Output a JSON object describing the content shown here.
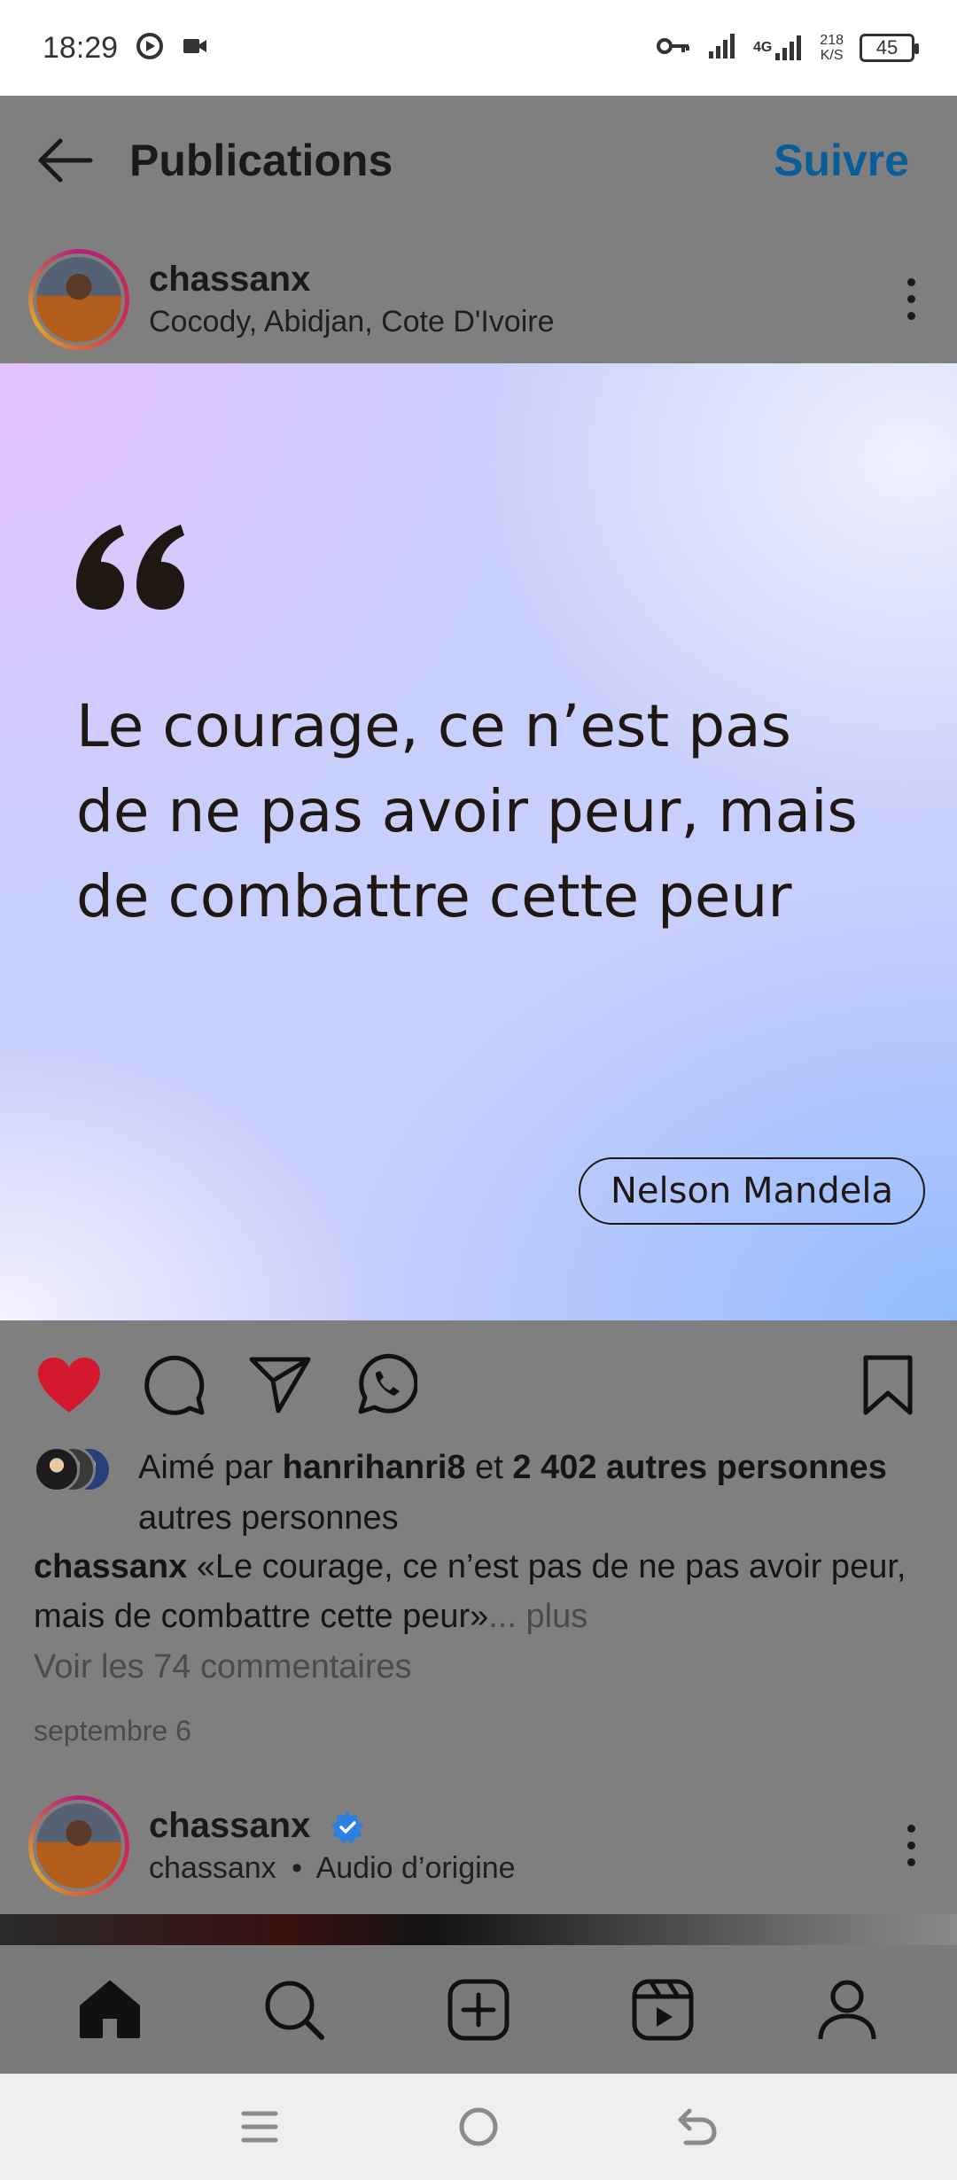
{
  "status_bar": {
    "time": "18:29",
    "network": "4G",
    "speed_value": "218",
    "speed_unit": "K/S",
    "battery": "45"
  },
  "header": {
    "title": "Publications",
    "follow_label": "Suivre"
  },
  "post": {
    "username": "chassanx",
    "location": "Cocody, Abidjan, Cote D'Ivoire",
    "quote_text": "Le courage, ce n’est pas de ne pas avoir peur, mais de combattre cette peur",
    "quote_author": "Nelson Mandela",
    "likes": {
      "prefix": "Aimé par ",
      "user": "hanrihanri8",
      "mid": " et ",
      "count": "2 402 autres personnes",
      "suffix": " autres personnes"
    },
    "caption_user": "chassanx",
    "caption_text": " «Le courage, ce n’est pas de ne pas avoir peur, mais de combattre cette peur»",
    "caption_more": "... plus",
    "comments_link": "Voir les 74 commentaires",
    "date": "septembre 6",
    "liked": true
  },
  "next_post": {
    "username": "chassanx",
    "sub_user": "chassanx",
    "separator": "•",
    "audio": "Audio d’origine"
  },
  "colors": {
    "like": "#d4182d",
    "follow": "#0a5d97",
    "verified": "#2d7fe0"
  },
  "icons": {
    "back": "arrow-left-icon",
    "like": "heart-icon",
    "comment": "comment-icon",
    "share": "send-icon",
    "whatsapp": "whatsapp-icon",
    "save": "bookmark-icon",
    "home": "home-icon",
    "search": "search-icon",
    "create": "add-square-icon",
    "reels": "reels-icon",
    "profile": "profile-icon"
  }
}
